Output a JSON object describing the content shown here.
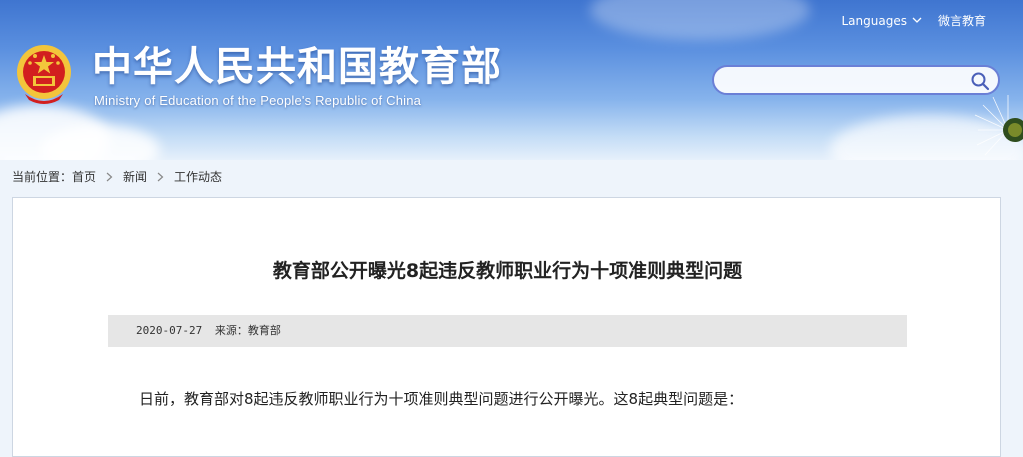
{
  "header": {
    "site_title": "中华人民共和国教育部",
    "site_subtitle": "Ministry of Education of the People's Republic of China",
    "languages_label": "Languages",
    "wechat_label": "微言教育",
    "search": {
      "placeholder": "",
      "value": ""
    }
  },
  "breadcrumb": {
    "prefix": "当前位置：",
    "items": [
      "首页",
      "新闻",
      "工作动态"
    ]
  },
  "article": {
    "title": "教育部公开曝光8起违反教师职业行为十项准则典型问题",
    "date": "2020-07-27",
    "source_label": "来源：",
    "source": "教育部",
    "first_paragraph": "日前，教育部对8起违反教师职业行为十项准则典型问题进行公开曝光。这8起典型问题是："
  },
  "colors": {
    "header_top": "#3f75d0",
    "search_border": "#6a7fd6",
    "emblem_red": "#d21f1f",
    "emblem_gold": "#f3c53b"
  },
  "icons": {
    "emblem": "national-emblem-icon",
    "search": "search-icon",
    "dropdown": "chevron-down-icon"
  }
}
